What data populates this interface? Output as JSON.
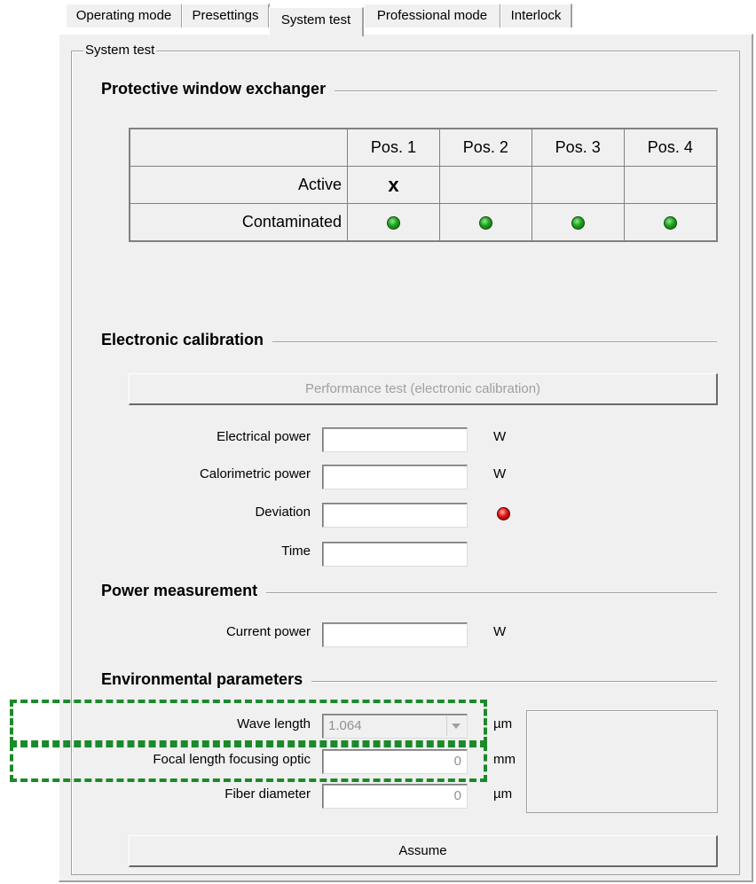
{
  "tabs": [
    "Operating mode",
    "Presettings",
    "System test",
    "Professional mode",
    "Interlock"
  ],
  "active_tab": "System test",
  "group_title": "System test",
  "protective_window": {
    "title": "Protective window exchanger",
    "columns": [
      "Pos. 1",
      "Pos. 2",
      "Pos. 3",
      "Pos. 4"
    ],
    "row_active_label": "Active",
    "active_marker": "x",
    "row_contaminated_label": "Contaminated",
    "contaminated_status": [
      "green",
      "green",
      "green",
      "green"
    ]
  },
  "electronic_calibration": {
    "title": "Electronic calibration",
    "button_label": "Performance test (electronic calibration)",
    "electrical_power_label": "Electrical power",
    "electrical_power_unit": "W",
    "calorimetric_power_label": "Calorimetric power",
    "calorimetric_power_unit": "W",
    "deviation_label": "Deviation",
    "deviation_status": "red",
    "time_label": "Time"
  },
  "power_measurement": {
    "title": "Power measurement",
    "current_power_label": "Current power",
    "current_power_unit": "W"
  },
  "environmental": {
    "title": "Environmental parameters",
    "wave_length_label": "Wave length",
    "wave_length_value": "1.064",
    "wave_length_unit": "µm",
    "focal_length_label": "Focal length focusing optic",
    "focal_length_value": "0",
    "focal_length_unit": "mm",
    "fiber_diameter_label": "Fiber diameter",
    "fiber_diameter_value": "0",
    "fiber_diameter_unit": "µm",
    "assume_label": "Assume"
  },
  "colors": {
    "highlight": "#1b8a2a",
    "led_ok": "#1ea11e",
    "led_error": "#e01010"
  }
}
